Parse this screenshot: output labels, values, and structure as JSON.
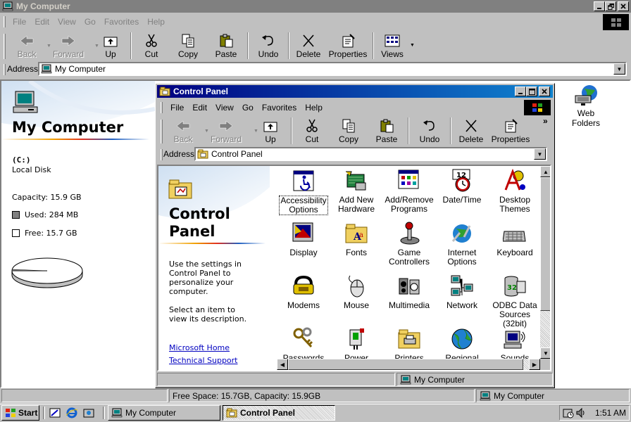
{
  "main_window": {
    "title": "My Computer",
    "menu": [
      "File",
      "Edit",
      "View",
      "Go",
      "Favorites",
      "Help"
    ],
    "toolbar": {
      "back": "Back",
      "forward": "Forward",
      "up": "Up",
      "cut": "Cut",
      "copy": "Copy",
      "paste": "Paste",
      "undo": "Undo",
      "delete": "Delete",
      "properties": "Properties",
      "views": "Views"
    },
    "address_label": "Address",
    "address_value": "My Computer",
    "panel": {
      "heading": "My Computer",
      "drive_letter": "(C:)",
      "drive_type": "Local Disk",
      "capacity": "Capacity: 15.9 GB",
      "used": "Used: 284 MB",
      "free": "Free: 15.7 GB",
      "used_fraction": 0.017
    },
    "desktop_item": "Web Folders",
    "status_left": "Free Space: 15.7GB, Capacity: 15.9GB",
    "status_right": "My Computer"
  },
  "control_panel": {
    "title": "Control Panel",
    "menu": [
      "File",
      "Edit",
      "View",
      "Go",
      "Favorites",
      "Help"
    ],
    "toolbar": {
      "back": "Back",
      "forward": "Forward",
      "up": "Up",
      "cut": "Cut",
      "copy": "Copy",
      "paste": "Paste",
      "undo": "Undo",
      "delete": "Delete",
      "properties": "Properties"
    },
    "toolbar_more": "»",
    "address_label": "Address",
    "address_value": "Control Panel",
    "panel": {
      "heading_line1": "Control",
      "heading_line2": "Panel",
      "desc1": "Use the settings in Control Panel to personalize your computer.",
      "desc2": "Select an item to view its description.",
      "link1": "Microsoft Home",
      "link2": "Technical Support"
    },
    "items": [
      {
        "line1": "Accessibility",
        "line2": "Options"
      },
      {
        "line1": "Add New",
        "line2": "Hardware"
      },
      {
        "line1": "Add/Remove",
        "line2": "Programs"
      },
      {
        "line1": "Date/Time",
        "line2": ""
      },
      {
        "line1": "Desktop",
        "line2": "Themes"
      },
      {
        "line1": "Display",
        "line2": ""
      },
      {
        "line1": "Fonts",
        "line2": ""
      },
      {
        "line1": "Game",
        "line2": "Controllers"
      },
      {
        "line1": "Internet",
        "line2": "Options"
      },
      {
        "line1": "Keyboard",
        "line2": ""
      },
      {
        "line1": "Modems",
        "line2": ""
      },
      {
        "line1": "Mouse",
        "line2": ""
      },
      {
        "line1": "Multimedia",
        "line2": ""
      },
      {
        "line1": "Network",
        "line2": ""
      },
      {
        "line1": "ODBC Data",
        "line2": "Sources (32bit)"
      },
      {
        "line1": "Passwords",
        "line2": ""
      },
      {
        "line1": "Power",
        "line2": ""
      },
      {
        "line1": "Printers",
        "line2": ""
      },
      {
        "line1": "Regional",
        "line2": ""
      },
      {
        "line1": "Sounds",
        "line2": ""
      }
    ],
    "status": "My Computer"
  },
  "taskbar": {
    "start": "Start",
    "tasks": [
      "My Computer",
      "Control Panel"
    ],
    "clock": "1:51 AM"
  },
  "colors": {
    "title_active_start": "#000080",
    "title_active_end": "#1084d0",
    "title_inactive": "#808080",
    "face": "#c0c0c0",
    "link": "#0000c0"
  }
}
